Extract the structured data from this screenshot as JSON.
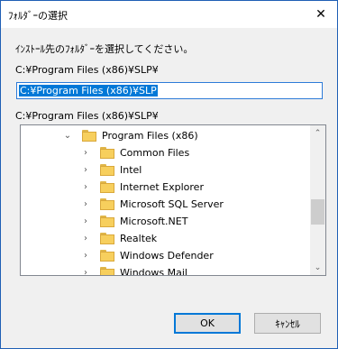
{
  "window": {
    "title": "ﾌｫﾙﾀﾞｰの選択",
    "close_glyph": "✕"
  },
  "dialog": {
    "prompt": "ｲﾝｽﾄｰﾙ先のﾌｫﾙﾀﾞｰを選択してください。",
    "current_path": "C:¥Program Files (x86)¥SLP¥",
    "input_value": "C:¥Program Files (x86)¥SLP",
    "selected_path": "C:¥Program Files (x86)¥SLP¥"
  },
  "tree": {
    "parent": {
      "label": "Program Files (x86)",
      "chevron": "⌄"
    },
    "items": [
      {
        "label": "Common Files",
        "chevron": "›"
      },
      {
        "label": "Intel",
        "chevron": "›"
      },
      {
        "label": "Internet Explorer",
        "chevron": "›"
      },
      {
        "label": "Microsoft SQL Server",
        "chevron": "›"
      },
      {
        "label": "Microsoft.NET",
        "chevron": "›"
      },
      {
        "label": "Realtek",
        "chevron": "›"
      },
      {
        "label": "Windows Defender",
        "chevron": "›"
      },
      {
        "label": "Windows Mail",
        "chevron": "›"
      }
    ]
  },
  "scrollbar": {
    "up_glyph": "⌃",
    "down_glyph": "⌄"
  },
  "buttons": {
    "ok": "OK",
    "cancel": "ｷｬﾝｾﾙ"
  },
  "colors": {
    "accent": "#0078d7",
    "folder": "#f7cf5d"
  }
}
